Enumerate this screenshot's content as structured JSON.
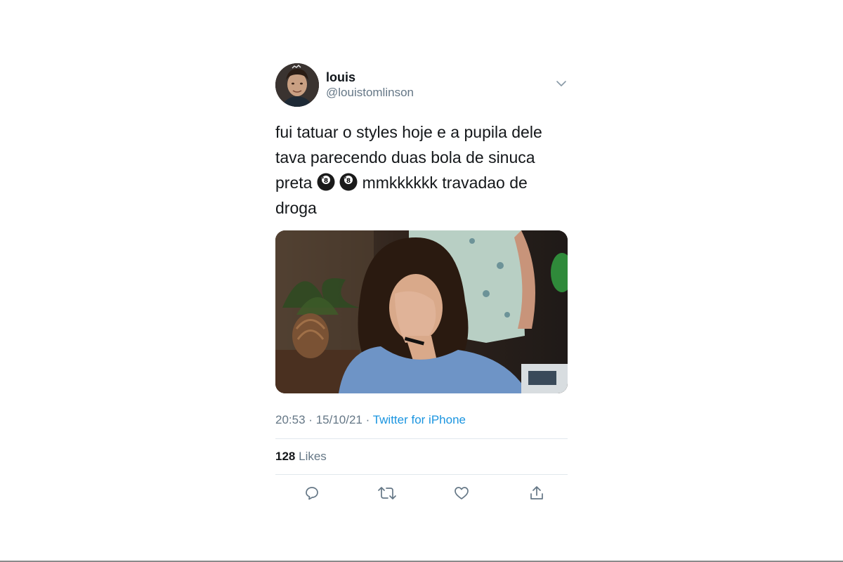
{
  "tweet": {
    "author": {
      "display_name": "louis",
      "handle": "@louistomlinson"
    },
    "text_parts": {
      "line1": "fui tatuar o styles hoje e a pupila dele",
      "line2": "tava parecendo duas bola de sinuca",
      "line3_start": "preta",
      "line3_end": "mmkkkkkk travadao de",
      "line4": "droga"
    },
    "emoji": [
      "8-ball-emoji",
      "8-ball-emoji"
    ],
    "meta": {
      "time": "20:53",
      "separator": "·",
      "date": "15/10/21",
      "source": "Twitter for iPhone"
    },
    "likes": {
      "count": "128",
      "label": "Likes"
    },
    "icons": {
      "reply": "reply-icon",
      "retweet": "retweet-icon",
      "like": "heart-icon",
      "share": "share-icon",
      "menu": "chevron-down-icon"
    },
    "colors": {
      "link": "#1b95e0",
      "secondary": "#657786",
      "primary_text": "#14171a"
    }
  }
}
